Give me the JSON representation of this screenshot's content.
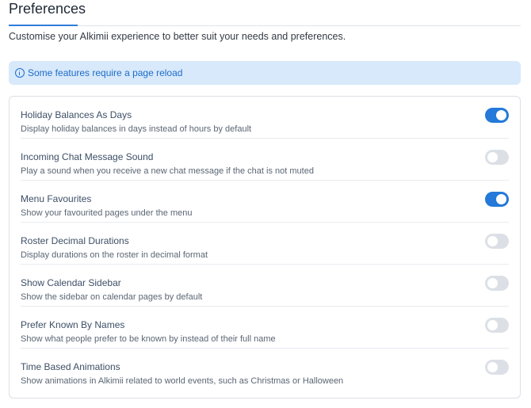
{
  "header": {
    "title": "Preferences",
    "subtitle": "Customise your Alkimii experience to better suit your needs and preferences."
  },
  "banner": {
    "icon": "info-icon",
    "text": "Some features require a page reload"
  },
  "colors": {
    "accent": "#2479d9",
    "toggle_off": "#dce0e6",
    "banner_bg": "#d8e9fb"
  },
  "preferences": [
    {
      "title": "Holiday Balances As Days",
      "description": "Display holiday balances in days instead of hours by default",
      "enabled": true
    },
    {
      "title": "Incoming Chat Message Sound",
      "description": "Play a sound when you receive a new chat message if the chat is not muted",
      "enabled": false
    },
    {
      "title": "Menu Favourites",
      "description": "Show your favourited pages under the menu",
      "enabled": true
    },
    {
      "title": "Roster Decimal Durations",
      "description": "Display durations on the roster in decimal format",
      "enabled": false
    },
    {
      "title": "Show Calendar Sidebar",
      "description": "Show the sidebar on calendar pages by default",
      "enabled": false
    },
    {
      "title": "Prefer Known By Names",
      "description": "Show what people prefer to be known by instead of their full name",
      "enabled": false
    },
    {
      "title": "Time Based Animations",
      "description": "Show animations in Alkimii related to world events, such as Christmas or Halloween",
      "enabled": false
    }
  ]
}
